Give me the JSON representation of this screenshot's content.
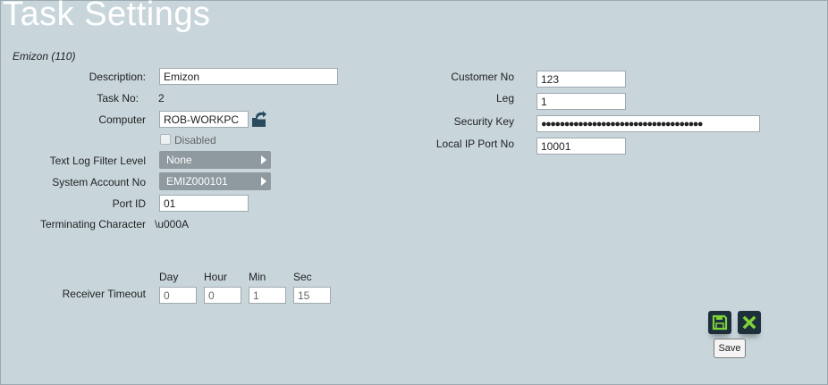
{
  "page": {
    "title": "Task Settings",
    "subtitle": "Emizon (110)"
  },
  "left": {
    "description": {
      "label": "Description:",
      "value": "Emizon"
    },
    "task_no": {
      "label": "Task No:",
      "value": "2"
    },
    "computer": {
      "label": "Computer",
      "value": "ROB-WORKPC",
      "icon": "folder-open-icon"
    },
    "disabled": {
      "label": "Disabled",
      "checked": false
    },
    "text_log": {
      "label": "Text Log Filter Level",
      "value": "None"
    },
    "system_account": {
      "label": "System Account No",
      "value": "EMIZ000101"
    },
    "port_id": {
      "label": "Port ID",
      "value": "01"
    },
    "terminating": {
      "label": "Terminating Character",
      "value": "\\u000A"
    }
  },
  "timeout": {
    "label": "Receiver Timeout",
    "headers": [
      "Day",
      "Hour",
      "Min",
      "Sec"
    ],
    "values": [
      "0",
      "0",
      "1",
      "15"
    ]
  },
  "right": {
    "customer_no": {
      "label": "Customer No",
      "value": "123"
    },
    "leg": {
      "label": "Leg",
      "value": "1"
    },
    "security_key": {
      "label": "Security Key",
      "value": "●●●●●●●●●●●●●●●●●●●●●●●●●●●●●●●●●●●"
    },
    "local_ip_port": {
      "label": "Local IP Port No",
      "value": "10001"
    }
  },
  "actions": {
    "save_tooltip": "Save",
    "save_icon": "floppy-disk-icon",
    "cancel_icon": "close-icon",
    "accent": "#7fd13a"
  }
}
